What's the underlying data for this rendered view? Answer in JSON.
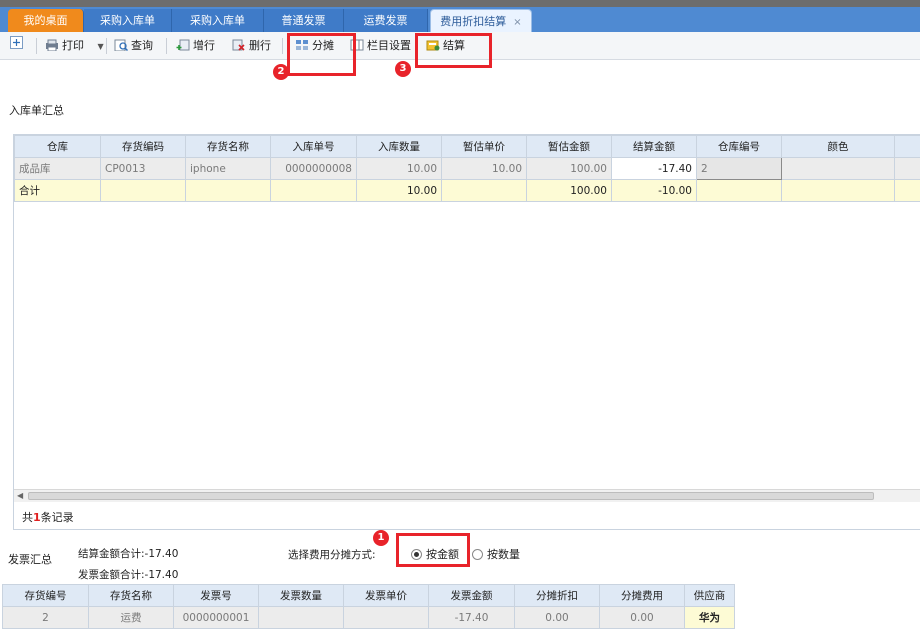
{
  "tabs": [
    {
      "label": "我的桌面"
    },
    {
      "label": "采购入库单"
    },
    {
      "label": "采购入库单"
    },
    {
      "label": "普通发票"
    },
    {
      "label": "运费发票"
    },
    {
      "label": "费用折扣结算",
      "close": "×"
    }
  ],
  "toolbar": {
    "print": "打印",
    "query": "查询",
    "add_row": "增行",
    "delete_row": "删行",
    "allocate": "分摊",
    "column_settings": "栏目设置",
    "settle": "结算"
  },
  "callouts": {
    "n1": "1",
    "n2": "2",
    "n3": "3"
  },
  "receipt_section": {
    "title": "入库单汇总",
    "columns": [
      "仓库",
      "存货编码",
      "存货名称",
      "入库单号",
      "入库数量",
      "暂估单价",
      "暂估金额",
      "结算金额",
      "仓库编号",
      "颜色"
    ],
    "row": [
      "成品库",
      "CP0013",
      "iphone",
      "0000000008",
      "10.00",
      "10.00",
      "100.00",
      "-17.40",
      "2",
      ""
    ],
    "total": [
      "合计",
      "",
      "",
      "",
      "10.00",
      "",
      "100.00",
      "-10.00",
      "",
      ""
    ],
    "record_count_prefix": "共",
    "record_count": "1",
    "record_count_suffix": "条记录"
  },
  "invoice_section": {
    "title": "发票汇总",
    "settle_total": "结算金额合计:-17.40",
    "invoice_total": "发票金额合计:-17.40",
    "method_label": "选择费用分摊方式:",
    "method_amount": "按金额",
    "method_quantity": "按数量",
    "columns": [
      "存货编号",
      "存货名称",
      "发票号",
      "发票数量",
      "发票单价",
      "发票金额",
      "分摊折扣",
      "分摊费用",
      "供应商"
    ],
    "row": [
      "2",
      "运费",
      "0000000001",
      "",
      "",
      "-17.40",
      "0.00",
      "0.00",
      "华为"
    ]
  }
}
